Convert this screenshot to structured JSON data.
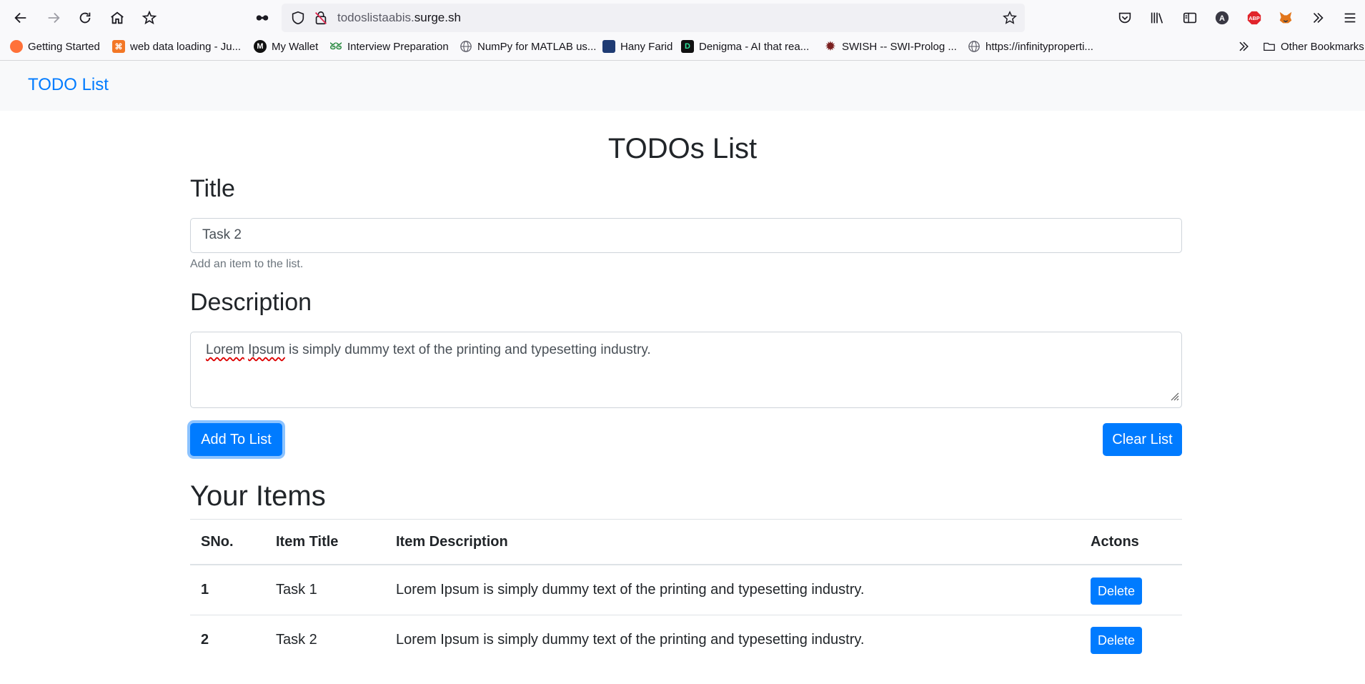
{
  "browser": {
    "url_prefix": "todoslistaabis.",
    "url_domain": "surge.sh",
    "bookmarks": [
      {
        "label": "Getting Started",
        "icon": "firefox-icon",
        "color": "#e66000"
      },
      {
        "label": "web data loading - Ju...",
        "icon": "jupyter-icon",
        "color": "#f37726"
      },
      {
        "label": "My Wallet",
        "icon": "wallet-icon",
        "color": "#111111"
      },
      {
        "label": "Interview Preparation",
        "icon": "gfg-icon",
        "color": "#2f8d46"
      },
      {
        "label": "NumPy for MATLAB us...",
        "icon": "globe-icon",
        "color": "#5b5b66"
      },
      {
        "label": "Hany Farid",
        "icon": "photo-icon",
        "color": "#1f3b73"
      },
      {
        "label": "Denigma - AI that rea...",
        "icon": "denigma-icon",
        "color": "#111111"
      },
      {
        "label": "SWISH -- SWI-Prolog ...",
        "icon": "swish-icon",
        "color": "#7a1f1f"
      },
      {
        "label": "https://infinityproperti...",
        "icon": "globe-icon",
        "color": "#5b5b66"
      }
    ],
    "other_bookmarks": "Other Bookmarks"
  },
  "navbar": {
    "brand": "TODO List"
  },
  "form": {
    "heading": "TODOs List",
    "title_label": "Title",
    "title_value": "Task 2",
    "title_help": "Add an item to the list.",
    "description_label": "Description",
    "description_word1": "Lorem",
    "description_word2": "Ipsum",
    "description_rest": " is simply dummy text of the printing and typesetting industry.",
    "add_button": "Add To List",
    "clear_button": "Clear List"
  },
  "items": {
    "heading": "Your Items",
    "columns": [
      "SNo.",
      "Item Title",
      "Item Description",
      "Actons"
    ],
    "rows": [
      {
        "sno": "1",
        "title": "Task 1",
        "description": "Lorem Ipsum is simply dummy text of the printing and typesetting industry.",
        "action": "Delete"
      },
      {
        "sno": "2",
        "title": "Task 2",
        "description": "Lorem Ipsum is simply dummy text of the printing and typesetting industry.",
        "action": "Delete"
      }
    ]
  }
}
